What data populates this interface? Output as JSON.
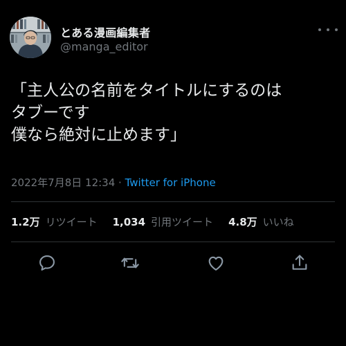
{
  "author": {
    "display_name": "とある漫画編集者",
    "handle": "@manga_editor",
    "avatar_icon": "avatar-illustration"
  },
  "tweet": {
    "text": "「主人公の名前をタイトルにするのは\nタブーです\n僕なら絶対に止めます」",
    "datetime": "2022年7月8日 12:34",
    "separator": "·",
    "source": "Twitter for iPhone"
  },
  "stats": {
    "retweets": {
      "count": "1.2万",
      "label": "リツイート"
    },
    "quotes": {
      "count": "1,034",
      "label": "引用ツイート"
    },
    "likes": {
      "count": "4.8万",
      "label": "いいね"
    }
  },
  "actions": {
    "icons": [
      "reply-icon",
      "retweet-icon",
      "like-icon",
      "share-icon"
    ]
  },
  "colors": {
    "background": "#000000",
    "text": "#e7e9ea",
    "secondary": "#71767b",
    "accent": "#1d9bf0",
    "divider": "#2f3336"
  }
}
